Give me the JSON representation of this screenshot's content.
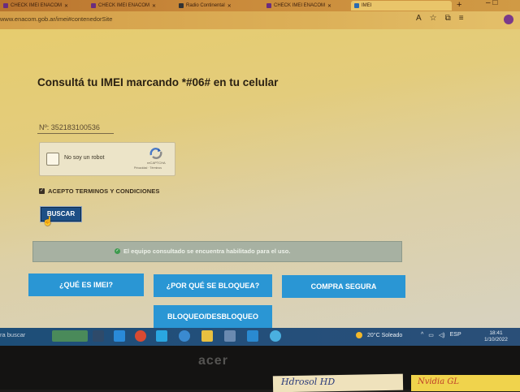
{
  "browser": {
    "tabs": [
      {
        "label": "CHECK IMEI ENACOM"
      },
      {
        "label": "CHECK IMEI ENACOM"
      },
      {
        "label": "Radio Continental"
      },
      {
        "label": "CHECK IMEI ENACOM"
      },
      {
        "label": "IMEI"
      }
    ],
    "url": "www.enacom.gob.ar/imei#contenedorSite",
    "new_tab": "+",
    "window_controls": "–  □"
  },
  "page": {
    "title": "Consultá tu IMEI marcando *#06# en tu celular",
    "imei_input": {
      "value": "Nº: 352183100536",
      "placeholder": "Nº:"
    },
    "recaptcha": {
      "label": "No soy un robot",
      "brand": "reCAPTCHA",
      "links": "Privacidad · Términos"
    },
    "terms": {
      "checked": true,
      "label": "ACEPTO TERMINOS Y CONDICIONES"
    },
    "search_button": "BUSCAR",
    "status_message": "El equipo consultado se encuentra habilitado para el uso.",
    "buttons": {
      "que_es_imei": "¿QUÉ ES IMEI?",
      "por_que_bloquea": "¿POR QUÉ SE BLOQUEA?",
      "compra_segura": "COMPRA SEGURA",
      "bloqueo": "BLOQUEO/DESBLOQUEO"
    },
    "colors": {
      "button_blue": "#2a96d4",
      "search_button": "#1d4f86",
      "status_banner": "#a7b1a2"
    }
  },
  "taskbar": {
    "search_placeholder": "ra buscar",
    "weather": "20°C  Soleado",
    "language": "ESP",
    "time": "18:41",
    "date": "1/10/2022"
  },
  "monitor": {
    "brand": "acer",
    "sticky_note_left": "Hdrosol HD",
    "sticky_note_right": "Nvidia GL"
  }
}
